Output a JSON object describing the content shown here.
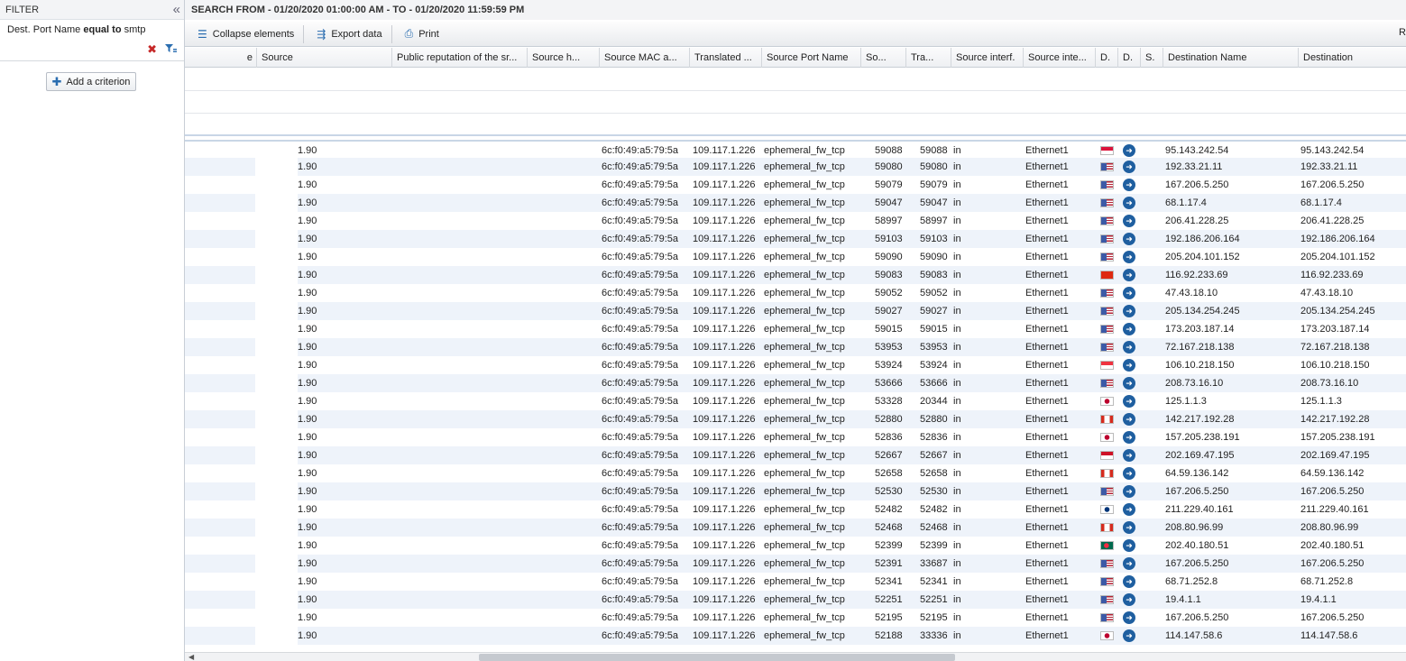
{
  "filter": {
    "title": "FILTER",
    "criterion": {
      "field": "Dest. Port Name",
      "operator": "equal to",
      "value": "smtp"
    },
    "add_criterion_label": "Add a criterion"
  },
  "search_title": "SEARCH FROM - 01/20/2020 01:00:00 AM - TO - 01/20/2020 11:59:59 PM",
  "toolbar": {
    "collapse_label": "Collapse elements",
    "export_label": "Export data",
    "print_label": "Print",
    "right_label": "R"
  },
  "columns": [
    "e",
    "Source",
    "Public reputation of the sr...",
    "Source h...",
    "Source MAC a...",
    "Translated ...",
    "Source Port Name",
    "So...",
    "Tra...",
    "Source interf.",
    "Source inte...",
    "D.",
    "D.",
    "S.",
    "Destination Name",
    "Destination"
  ],
  "row_defaults": {
    "source": "1.90",
    "mac": "6c:f0:49:a5:79:5a",
    "translated": "109.117.1.226",
    "port_name": "ephemeral_fw_tcp",
    "direction": "in",
    "interface": "Ethernet1"
  },
  "rows": [
    {
      "sp": "59088",
      "tp": "59088",
      "flag": "pl",
      "dest": "95.143.242.54"
    },
    {
      "sp": "59080",
      "tp": "59080",
      "flag": "us",
      "dest": "192.33.21.11"
    },
    {
      "sp": "59079",
      "tp": "59079",
      "flag": "us",
      "dest": "167.206.5.250"
    },
    {
      "sp": "59047",
      "tp": "59047",
      "flag": "us",
      "dest": "68.1.17.4"
    },
    {
      "sp": "58997",
      "tp": "58997",
      "flag": "us",
      "dest": "206.41.228.25"
    },
    {
      "sp": "59103",
      "tp": "59103",
      "flag": "us",
      "dest": "192.186.206.164"
    },
    {
      "sp": "59090",
      "tp": "59090",
      "flag": "us",
      "dest": "205.204.101.152"
    },
    {
      "sp": "59083",
      "tp": "59083",
      "flag": "hk",
      "dest": "116.92.233.69"
    },
    {
      "sp": "59052",
      "tp": "59052",
      "flag": "us",
      "dest": "47.43.18.10"
    },
    {
      "sp": "59027",
      "tp": "59027",
      "flag": "us",
      "dest": "205.134.254.245"
    },
    {
      "sp": "59015",
      "tp": "59015",
      "flag": "us",
      "dest": "173.203.187.14"
    },
    {
      "sp": "53953",
      "tp": "53953",
      "flag": "us",
      "dest": "72.167.218.138"
    },
    {
      "sp": "53924",
      "tp": "53924",
      "flag": "sg",
      "dest": "106.10.218.150"
    },
    {
      "sp": "53666",
      "tp": "53666",
      "flag": "us",
      "dest": "208.73.16.10"
    },
    {
      "sp": "53328",
      "tp": "20344",
      "flag": "jp",
      "dest": "125.1.1.3"
    },
    {
      "sp": "52880",
      "tp": "52880",
      "flag": "ca",
      "dest": "142.217.192.28"
    },
    {
      "sp": "52836",
      "tp": "52836",
      "flag": "jp",
      "dest": "157.205.238.191"
    },
    {
      "sp": "52667",
      "tp": "52667",
      "flag": "id",
      "dest": "202.169.47.195"
    },
    {
      "sp": "52658",
      "tp": "52658",
      "flag": "ca",
      "dest": "64.59.136.142"
    },
    {
      "sp": "52530",
      "tp": "52530",
      "flag": "us",
      "dest": "167.206.5.250"
    },
    {
      "sp": "52482",
      "tp": "52482",
      "flag": "kr",
      "dest": "211.229.40.161"
    },
    {
      "sp": "52468",
      "tp": "52468",
      "flag": "ca",
      "dest": "208.80.96.99"
    },
    {
      "sp": "52399",
      "tp": "52399",
      "flag": "bd",
      "dest": "202.40.180.51"
    },
    {
      "sp": "52391",
      "tp": "33687",
      "flag": "us",
      "dest": "167.206.5.250"
    },
    {
      "sp": "52341",
      "tp": "52341",
      "flag": "us",
      "dest": "68.71.252.8"
    },
    {
      "sp": "52251",
      "tp": "52251",
      "flag": "us",
      "dest": "19.4.1.1"
    },
    {
      "sp": "52195",
      "tp": "52195",
      "flag": "us",
      "dest": "167.206.5.250"
    },
    {
      "sp": "52188",
      "tp": "33336",
      "flag": "jp",
      "dest": "114.147.58.6"
    }
  ],
  "flag_colors": {
    "us": "#3c5aa6",
    "pl": "#dc143c",
    "hk": "#de2910",
    "sg": "#ef3340",
    "jp": "#bc002d",
    "ca": "#d52b1e",
    "id": "#ce1126",
    "kr": "#003478",
    "bd": "#006a4e"
  }
}
